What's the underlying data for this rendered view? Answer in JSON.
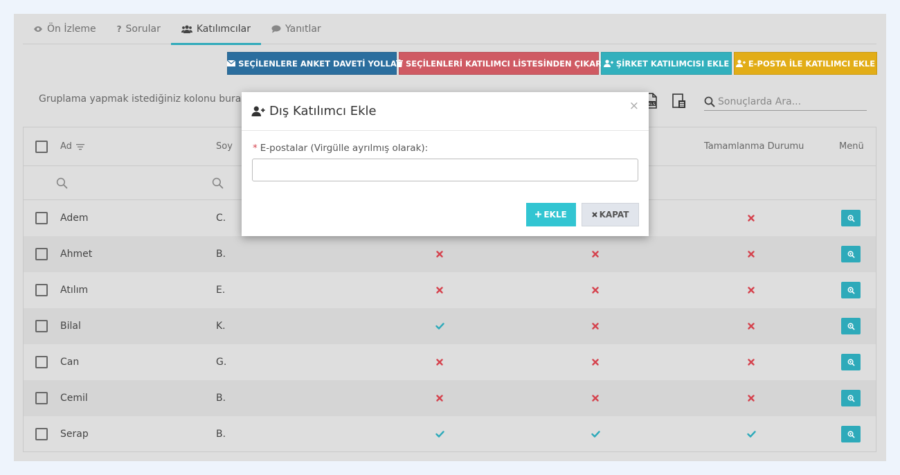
{
  "tabs": [
    {
      "label": "Ön İzleme",
      "icon": "eye-icon"
    },
    {
      "label": "Sorular",
      "icon": "question-icon"
    },
    {
      "label": "Katılımcılar",
      "icon": "users-icon"
    },
    {
      "label": "Yanıtlar",
      "icon": "comment-icon"
    }
  ],
  "active_tab": "Katılımcılar",
  "actions": {
    "invite": "SEÇİLENLERE ANKET DAVETİ YOLLA",
    "remove": "SEÇİLENLERİ KATILIMCI LİSTESİNDEN ÇIKAR",
    "company": "ŞİRKET KATILIMCISI EKLE",
    "email": "E-POSTA İLE KATILIMCI EKLE"
  },
  "toolbar": {
    "group_hint": "Gruplama yapmak istediğiniz kolonu buray",
    "search_placeholder": "Sonuçlarda Ara..."
  },
  "grid": {
    "headers": {
      "ad": "Ad",
      "soyad": "Soy",
      "completion": "Tamamlanma Durumu",
      "menu": "Menü"
    },
    "rows": [
      {
        "ad": "Adem",
        "soyad": "C.",
        "c1": "",
        "c2": "",
        "c3": "x"
      },
      {
        "ad": "Ahmet",
        "soyad": "B.",
        "c1": "x",
        "c2": "x",
        "c3": "x"
      },
      {
        "ad": "Atılım",
        "soyad": "E.",
        "c1": "x",
        "c2": "x",
        "c3": "x"
      },
      {
        "ad": "Bilal",
        "soyad": "K.",
        "c1": "check",
        "c2": "x",
        "c3": "x"
      },
      {
        "ad": "Can",
        "soyad": "G.",
        "c1": "x",
        "c2": "x",
        "c3": "x"
      },
      {
        "ad": "Cemil",
        "soyad": "B.",
        "c1": "x",
        "c2": "x",
        "c3": "x"
      },
      {
        "ad": "Serap",
        "soyad": "B.",
        "c1": "check",
        "c2": "check",
        "c3": "check"
      }
    ]
  },
  "modal": {
    "title": "Dış Katılımcı Ekle",
    "label": "E-postalar (Virgülle ayrılmış olarak):",
    "required_mark": "*",
    "close_x": "×",
    "email_value": "",
    "add_button": "EKLE",
    "close_button": "KAPAT"
  },
  "colors": {
    "teal": "#2eaaba",
    "blue": "#2b6e9e",
    "red": "#cf5a63",
    "yellow": "#e2ad17",
    "x_mark": "#d5434e"
  }
}
